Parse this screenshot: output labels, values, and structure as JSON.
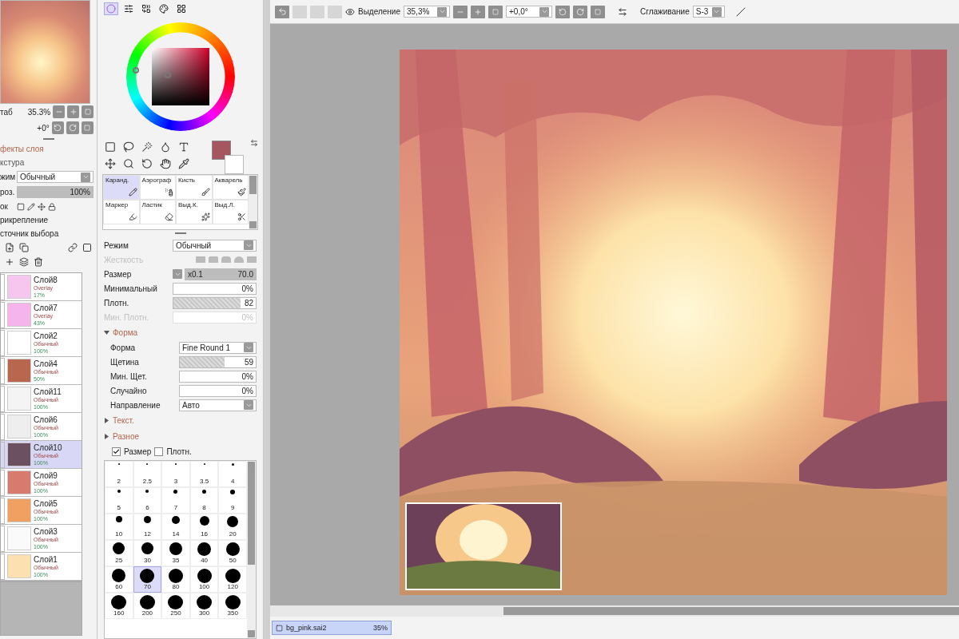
{
  "toolbar": {
    "selection_label": "Выделение",
    "zoom": "35,3%",
    "angle": "+0,0°",
    "stabilizer_label": "Сглаживание",
    "stabilizer": "S-3"
  },
  "navigator": {
    "zoom_label": "таб",
    "zoom": "35.3%",
    "angle": "+0°"
  },
  "layer_properties": {
    "effects": "фекты слоя",
    "texture": "кстура",
    "mode_label": "жим",
    "mode": "Обычный",
    "opacity": {
      "label": "роз.",
      "value": "100%",
      "level": 1
    },
    "lock_label": "ок",
    "clipping": "рикрепление",
    "selection_source": "сточник выбора"
  },
  "layers": [
    {
      "name": "Слой8",
      "mode": "Overlay",
      "opacity": "17%",
      "color": "#f7c6ee",
      "selected": false
    },
    {
      "name": "Слой7",
      "mode": "Overlay",
      "opacity": "43%",
      "color": "#f5b4ea",
      "selected": false
    },
    {
      "name": "Слой2",
      "mode": "Обычный",
      "opacity": "100%",
      "color": "#ffffff",
      "selected": false
    },
    {
      "name": "Слой4",
      "mode": "Обычный",
      "opacity": "50%",
      "color": "#b8664e",
      "selected": false
    },
    {
      "name": "Слой11",
      "mode": "Обычный",
      "opacity": "100%",
      "color": "#f4f4f4",
      "selected": false
    },
    {
      "name": "Слой6",
      "mode": "Обычный",
      "opacity": "100%",
      "color": "#eeeeee",
      "selected": false
    },
    {
      "name": "Слой10",
      "mode": "Обычный",
      "opacity": "100%",
      "color": "#6a5060",
      "selected": true
    },
    {
      "name": "Слой9",
      "mode": "Обычный",
      "opacity": "100%",
      "color": "#d87a6e",
      "selected": false
    },
    {
      "name": "Слой5",
      "mode": "Обычный",
      "opacity": "100%",
      "color": "#f0a060",
      "selected": false
    },
    {
      "name": "Слой3",
      "mode": "Обычный",
      "opacity": "100%",
      "color": "#fafafa",
      "selected": false
    },
    {
      "name": "Слой1",
      "mode": "Обычный",
      "opacity": "100%",
      "color": "#fde0b0",
      "selected": false
    }
  ],
  "color_tabs": [
    {
      "kind": "wheel",
      "selected": true
    },
    {
      "kind": "sliders",
      "selected": false
    },
    {
      "kind": "mixer",
      "selected": false
    },
    {
      "kind": "palette",
      "selected": false
    },
    {
      "kind": "swatches",
      "selected": false
    }
  ],
  "brush_tools": [
    {
      "label": "Каранд.",
      "kind": "pencil",
      "selected": true
    },
    {
      "label": "Аэрограф",
      "kind": "airbrush",
      "selected": false
    },
    {
      "label": "Кисть",
      "kind": "brush",
      "selected": false
    },
    {
      "label": "Акварель",
      "kind": "watercolor",
      "selected": false
    },
    {
      "label": "Маркер",
      "kind": "marker",
      "selected": false
    },
    {
      "label": "Ластик",
      "kind": "eraser",
      "selected": false
    },
    {
      "label": "Выд.К.",
      "kind": "select",
      "selected": false
    },
    {
      "label": "Выд.Л.",
      "kind": "deselect",
      "selected": false
    }
  ],
  "settings": [
    {
      "kind": "select",
      "label": "Режим",
      "value": "Обычный",
      "disabled": false
    },
    {
      "kind": "hardness",
      "label": "Жесткость",
      "disabled": true
    },
    {
      "kind": "size",
      "label": "Размер",
      "multiplier": "x0.1",
      "value": "70.0",
      "level": 1,
      "disabled": false
    },
    {
      "kind": "slider",
      "label": "Минимальный",
      "value": "0%",
      "level": 0,
      "disabled": false
    },
    {
      "kind": "slider",
      "label": "Плотн.",
      "value": "82",
      "level": 0.82,
      "disabled": false
    },
    {
      "kind": "slider",
      "label": "Мин. Плотн.",
      "value": "0%",
      "level": 0,
      "disabled": true
    }
  ],
  "sections": [
    {
      "title": "Форма",
      "expanded": true,
      "settings": [
        {
          "kind": "select",
          "label": "Форма",
          "value": "Fine Round 1",
          "disabled": false
        },
        {
          "kind": "slider",
          "label": "Щетина",
          "value": "59",
          "level": 0.59,
          "disabled": false
        },
        {
          "kind": "slider",
          "label": "Мин. Щет.",
          "value": "0%",
          "level": 0,
          "disabled": false
        },
        {
          "kind": "slider",
          "label": "Случайно",
          "value": "0%",
          "level": 0,
          "disabled": false
        },
        {
          "kind": "select",
          "label": "Направление",
          "value": "Авто",
          "disabled": false
        }
      ]
    },
    {
      "title": "Текст.",
      "expanded": false
    },
    {
      "title": "Разное",
      "expanded": false
    }
  ],
  "pressure_options": [
    {
      "label": "Размер",
      "checked": true
    },
    {
      "label": "Плотн.",
      "checked": false
    }
  ],
  "brush_sizes": [
    {
      "label": "2",
      "selected": false
    },
    {
      "label": "2.5",
      "selected": false
    },
    {
      "label": "3",
      "selected": false
    },
    {
      "label": "3.5",
      "selected": false
    },
    {
      "label": "4",
      "selected": false
    },
    {
      "label": "5",
      "selected": false
    },
    {
      "label": "6",
      "selected": false
    },
    {
      "label": "7",
      "selected": false
    },
    {
      "label": "8",
      "selected": false
    },
    {
      "label": "9",
      "selected": false
    },
    {
      "label": "10",
      "selected": false
    },
    {
      "label": "12",
      "selected": false
    },
    {
      "label": "14",
      "selected": false
    },
    {
      "label": "16",
      "selected": false
    },
    {
      "label": "20",
      "selected": false
    },
    {
      "label": "25",
      "selected": false
    },
    {
      "label": "30",
      "selected": false
    },
    {
      "label": "35",
      "selected": false
    },
    {
      "label": "40",
      "selected": false
    },
    {
      "label": "50",
      "selected": false
    },
    {
      "label": "60",
      "selected": false
    },
    {
      "label": "70",
      "selected": true
    },
    {
      "label": "80",
      "selected": false
    },
    {
      "label": "100",
      "selected": false
    },
    {
      "label": "120",
      "selected": false
    },
    {
      "label": "160",
      "selected": false
    },
    {
      "label": "200",
      "selected": false
    },
    {
      "label": "250",
      "selected": false
    },
    {
      "label": "300",
      "selected": false
    },
    {
      "label": "350",
      "selected": false
    }
  ],
  "document_tabs": [
    {
      "name": "bg_pink.sai2",
      "zoom": "35%",
      "selected": true
    }
  ]
}
